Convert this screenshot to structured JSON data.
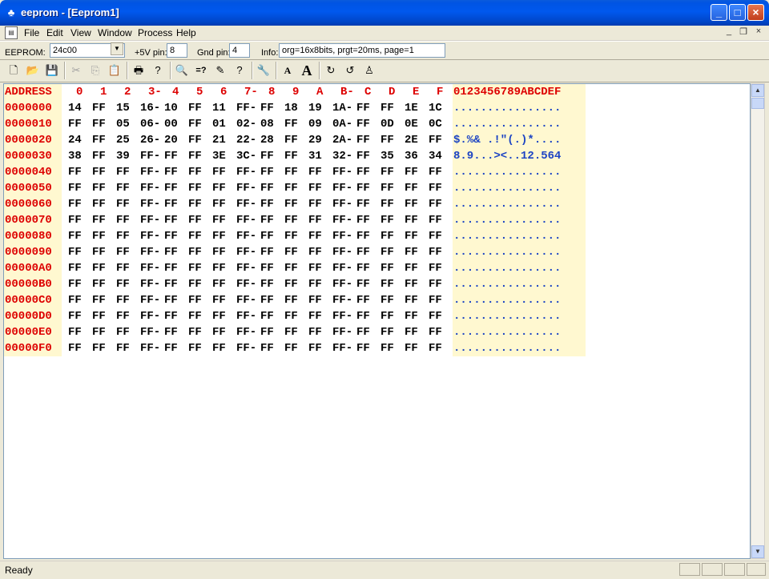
{
  "window": {
    "title": "eeprom - [Eeprom1]",
    "controls": {
      "minimize": "_",
      "maximize": "□",
      "close": "×"
    }
  },
  "menu": [
    "File",
    "Edit",
    "View",
    "Window",
    "Process",
    "Help"
  ],
  "mdi_controls": [
    "_",
    "❐",
    "×"
  ],
  "infobar": {
    "eeprom_label": "EEPROM:",
    "eeprom_value": "24c00",
    "vcc_label": "+5V pin:",
    "vcc_value": "8",
    "gnd_label": "Gnd pin:",
    "gnd_value": "4",
    "info_label": "Info:",
    "info_value": "org=16x8bits, prgt=20ms, page=1"
  },
  "toolbar": [
    {
      "icon": "new-icon",
      "glyph": "🗋",
      "enabled": true
    },
    {
      "icon": "open-icon",
      "glyph": "📂",
      "enabled": true
    },
    {
      "icon": "save-icon",
      "glyph": "💾",
      "enabled": true
    },
    {
      "sep": true
    },
    {
      "icon": "cut-icon",
      "glyph": "✂",
      "enabled": false
    },
    {
      "icon": "copy-icon",
      "glyph": "⎘",
      "enabled": false
    },
    {
      "icon": "paste-icon",
      "glyph": "📋",
      "enabled": false
    },
    {
      "sep": true
    },
    {
      "icon": "print-icon",
      "glyph": "🖶",
      "enabled": true
    },
    {
      "icon": "help-icon",
      "glyph": "?",
      "enabled": true
    },
    {
      "sep": true
    },
    {
      "icon": "find-icon",
      "glyph": "🔍",
      "enabled": true
    },
    {
      "icon": "compare-icon",
      "glyph": "=?",
      "enabled": true
    },
    {
      "icon": "edit-icon",
      "glyph": "✎",
      "enabled": true
    },
    {
      "icon": "context-help-icon",
      "glyph": "?",
      "enabled": true
    },
    {
      "sep": true
    },
    {
      "icon": "settings-icon",
      "glyph": "🔧",
      "enabled": true
    },
    {
      "sep": true
    },
    {
      "icon": "font-small-icon",
      "glyph": "A",
      "enabled": true
    },
    {
      "icon": "font-large-icon",
      "glyph": "A",
      "enabled": true
    },
    {
      "sep": true
    },
    {
      "icon": "read-icon",
      "glyph": "↻",
      "enabled": true
    },
    {
      "icon": "write-icon",
      "glyph": "↺",
      "enabled": true
    },
    {
      "icon": "programmer-icon",
      "glyph": "♙",
      "enabled": true
    }
  ],
  "hex": {
    "header": [
      "ADDRESS",
      "0",
      "1",
      "2",
      "3-",
      "4",
      "5",
      "6",
      "7-",
      "8",
      "9",
      "A",
      "B-",
      "C",
      "D",
      "E",
      "F",
      "0123456789ABCDEF"
    ],
    "rows": [
      {
        "addr": "0000000",
        "bytes": [
          "14",
          "FF",
          "15",
          "16-",
          "10",
          "FF",
          "11",
          "FF-",
          "FF",
          "18",
          "19",
          "1A-",
          "FF",
          "FF",
          "1E",
          "1C"
        ],
        "ascii": "................"
      },
      {
        "addr": "0000010",
        "bytes": [
          "FF",
          "FF",
          "05",
          "06-",
          "00",
          "FF",
          "01",
          "02-",
          "08",
          "FF",
          "09",
          "0A-",
          "FF",
          "0D",
          "0E",
          "0C"
        ],
        "ascii": "................"
      },
      {
        "addr": "0000020",
        "bytes": [
          "24",
          "FF",
          "25",
          "26-",
          "20",
          "FF",
          "21",
          "22-",
          "28",
          "FF",
          "29",
          "2A-",
          "FF",
          "FF",
          "2E",
          "FF"
        ],
        "ascii": "$.%& .!\"(.)*...."
      },
      {
        "addr": "0000030",
        "bytes": [
          "38",
          "FF",
          "39",
          "FF-",
          "FF",
          "FF",
          "3E",
          "3C-",
          "FF",
          "FF",
          "31",
          "32-",
          "FF",
          "35",
          "36",
          "34"
        ],
        "ascii": "8.9...><..12.564"
      },
      {
        "addr": "0000040",
        "bytes": [
          "FF",
          "FF",
          "FF",
          "FF-",
          "FF",
          "FF",
          "FF",
          "FF-",
          "FF",
          "FF",
          "FF",
          "FF-",
          "FF",
          "FF",
          "FF",
          "FF"
        ],
        "ascii": "................"
      },
      {
        "addr": "0000050",
        "bytes": [
          "FF",
          "FF",
          "FF",
          "FF-",
          "FF",
          "FF",
          "FF",
          "FF-",
          "FF",
          "FF",
          "FF",
          "FF-",
          "FF",
          "FF",
          "FF",
          "FF"
        ],
        "ascii": "................"
      },
      {
        "addr": "0000060",
        "bytes": [
          "FF",
          "FF",
          "FF",
          "FF-",
          "FF",
          "FF",
          "FF",
          "FF-",
          "FF",
          "FF",
          "FF",
          "FF-",
          "FF",
          "FF",
          "FF",
          "FF"
        ],
        "ascii": "................"
      },
      {
        "addr": "0000070",
        "bytes": [
          "FF",
          "FF",
          "FF",
          "FF-",
          "FF",
          "FF",
          "FF",
          "FF-",
          "FF",
          "FF",
          "FF",
          "FF-",
          "FF",
          "FF",
          "FF",
          "FF"
        ],
        "ascii": "................"
      },
      {
        "addr": "0000080",
        "bytes": [
          "FF",
          "FF",
          "FF",
          "FF-",
          "FF",
          "FF",
          "FF",
          "FF-",
          "FF",
          "FF",
          "FF",
          "FF-",
          "FF",
          "FF",
          "FF",
          "FF"
        ],
        "ascii": "................"
      },
      {
        "addr": "0000090",
        "bytes": [
          "FF",
          "FF",
          "FF",
          "FF-",
          "FF",
          "FF",
          "FF",
          "FF-",
          "FF",
          "FF",
          "FF",
          "FF-",
          "FF",
          "FF",
          "FF",
          "FF"
        ],
        "ascii": "................"
      },
      {
        "addr": "00000A0",
        "bytes": [
          "FF",
          "FF",
          "FF",
          "FF-",
          "FF",
          "FF",
          "FF",
          "FF-",
          "FF",
          "FF",
          "FF",
          "FF-",
          "FF",
          "FF",
          "FF",
          "FF"
        ],
        "ascii": "................"
      },
      {
        "addr": "00000B0",
        "bytes": [
          "FF",
          "FF",
          "FF",
          "FF-",
          "FF",
          "FF",
          "FF",
          "FF-",
          "FF",
          "FF",
          "FF",
          "FF-",
          "FF",
          "FF",
          "FF",
          "FF"
        ],
        "ascii": "................"
      },
      {
        "addr": "00000C0",
        "bytes": [
          "FF",
          "FF",
          "FF",
          "FF-",
          "FF",
          "FF",
          "FF",
          "FF-",
          "FF",
          "FF",
          "FF",
          "FF-",
          "FF",
          "FF",
          "FF",
          "FF"
        ],
        "ascii": "................"
      },
      {
        "addr": "00000D0",
        "bytes": [
          "FF",
          "FF",
          "FF",
          "FF-",
          "FF",
          "FF",
          "FF",
          "FF-",
          "FF",
          "FF",
          "FF",
          "FF-",
          "FF",
          "FF",
          "FF",
          "FF"
        ],
        "ascii": "................"
      },
      {
        "addr": "00000E0",
        "bytes": [
          "FF",
          "FF",
          "FF",
          "FF-",
          "FF",
          "FF",
          "FF",
          "FF-",
          "FF",
          "FF",
          "FF",
          "FF-",
          "FF",
          "FF",
          "FF",
          "FF"
        ],
        "ascii": "................"
      },
      {
        "addr": "00000F0",
        "bytes": [
          "FF",
          "FF",
          "FF",
          "FF-",
          "FF",
          "FF",
          "FF",
          "FF-",
          "FF",
          "FF",
          "FF",
          "FF-",
          "FF",
          "FF",
          "FF",
          "FF"
        ],
        "ascii": "................"
      }
    ]
  },
  "status": {
    "text": "Ready"
  },
  "colors": {
    "header": "#dd0000",
    "address": "#dd0000",
    "bytes": "#000000",
    "ascii": "#1c44c4",
    "highlight": "#fff8d0"
  }
}
